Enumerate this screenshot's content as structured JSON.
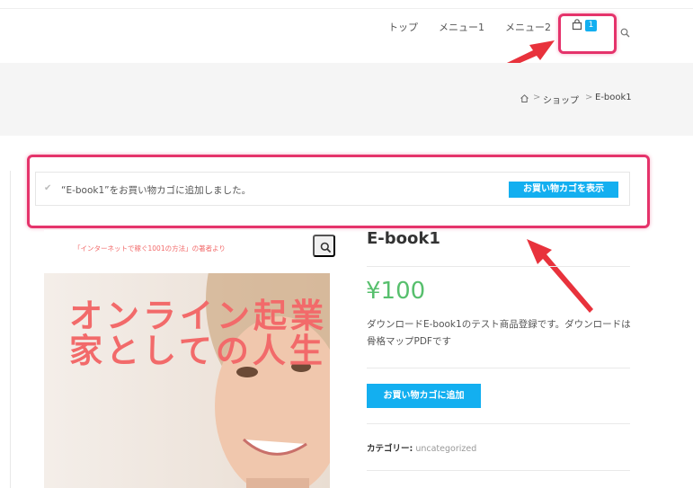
{
  "header": {
    "nav": [
      "トップ",
      "メニュー1",
      "メニュー2"
    ],
    "cart_count": "1",
    "cart_icon": "shopping-bag-icon",
    "search_icon": "search-icon"
  },
  "breadcrumb": {
    "home_icon": "home-icon",
    "sep": ">",
    "shop": "ショップ",
    "current": "E-book1"
  },
  "notice": {
    "text": "“E-book1”をお買い物カゴに追加しました。",
    "button": "お買い物カゴを表示"
  },
  "product": {
    "image_caption": "「インターネットで稼ぐ1001の方法」の著者より",
    "image_title": "オンライン起業家としての人生",
    "title": "E-book1",
    "price": "¥100",
    "description": "ダウンロードE-book1のテスト商品登録です。ダウンロードは骨格マップPDFです",
    "add_to_cart": "お買い物カゴに追加",
    "category_label": "カテゴリー:",
    "category": "uncategorized"
  },
  "colors": {
    "accent": "#13aff0",
    "price": "#57bf6d",
    "highlight": "#e5336b",
    "arrow": "#e8323c"
  }
}
